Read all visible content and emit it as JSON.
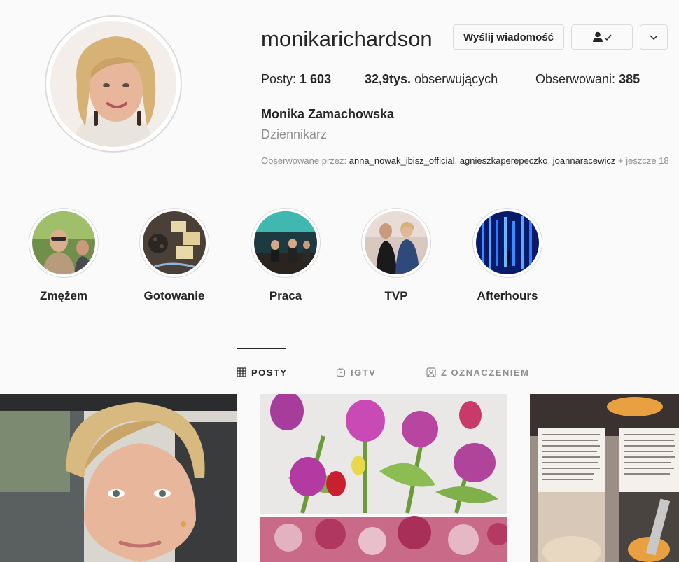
{
  "profile": {
    "username": "monikarichardson",
    "full_name": "Monika Zamachowska",
    "category": "Dziennikarz",
    "stats": {
      "posts_label": "Posty: ",
      "posts_value": "1 603",
      "followers_value": "32,9tys.",
      "followers_label": " obserwujących",
      "following_label": "Obserwowani: ",
      "following_value": "385"
    },
    "followed_by": {
      "prefix": "Obserwowane przez: ",
      "accounts": [
        "anna_nowak_ibisz_official",
        "agnieszkaperepeczko",
        "joannaracewicz"
      ],
      "more": "+ jeszcze 18"
    }
  },
  "actions": {
    "message_label": "Wyślij wiadomość",
    "following_icon": "user-check-icon",
    "more_icon": "chevron-down-icon"
  },
  "highlights": [
    {
      "label": "Zmężem"
    },
    {
      "label": "Gotowanie"
    },
    {
      "label": "Praca"
    },
    {
      "label": "TVP"
    },
    {
      "label": "Afterhours"
    }
  ],
  "tabs": [
    {
      "label": "POSTY",
      "icon": "grid-icon",
      "active": true
    },
    {
      "label": "IGTV",
      "icon": "igtv-icon",
      "active": false
    },
    {
      "label": "Z OZNACZENIEM",
      "icon": "tagged-icon",
      "active": false
    }
  ],
  "colors": {
    "background": "#fafafa",
    "text": "#262626",
    "muted": "#8e8e8e",
    "border": "#dbdbdb"
  }
}
